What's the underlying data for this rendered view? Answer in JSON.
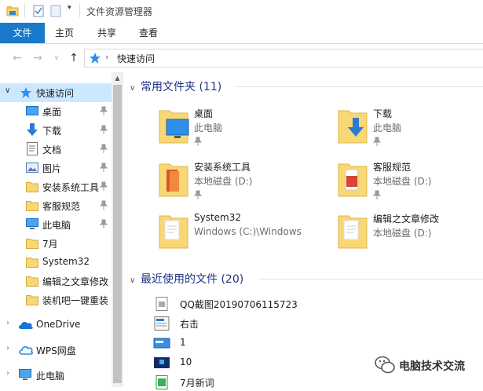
{
  "window": {
    "title": "文件资源管理器"
  },
  "ribbon": {
    "tabs": [
      "文件",
      "主页",
      "共享",
      "查看"
    ]
  },
  "address": {
    "path": "快速访问"
  },
  "nav": {
    "quick_access": "快速访问",
    "items": [
      {
        "label": "桌面",
        "pinned": true
      },
      {
        "label": "下载",
        "pinned": true
      },
      {
        "label": "文档",
        "pinned": true
      },
      {
        "label": "图片",
        "pinned": true
      },
      {
        "label": "安装系统工具",
        "pinned": true
      },
      {
        "label": "客服规范",
        "pinned": true
      },
      {
        "label": "此电脑",
        "pinned": true
      },
      {
        "label": "7月",
        "pinned": false
      },
      {
        "label": "System32",
        "pinned": false
      },
      {
        "label": "编辑之文章修改",
        "pinned": false
      },
      {
        "label": "装机吧一键重装",
        "pinned": false
      }
    ],
    "onedrive": "OneDrive",
    "wps": "WPS网盘",
    "this_pc": "此电脑"
  },
  "frequent": {
    "title": "常用文件夹 (11)",
    "folders": [
      {
        "name": "桌面",
        "location": "此电脑",
        "pinned": true
      },
      {
        "name": "下载",
        "location": "此电脑",
        "pinned": true
      },
      {
        "name": "安装系统工具",
        "location": "本地磁盘 (D:)",
        "pinned": true
      },
      {
        "name": "客服规范",
        "location": "本地磁盘 (D:)",
        "pinned": true
      },
      {
        "name": "System32",
        "location": "Windows (C:)\\Windows",
        "pinned": false
      },
      {
        "name": "编辑之文章修改",
        "location": "本地磁盘 (D:)",
        "pinned": false
      }
    ]
  },
  "recent": {
    "title": "最近使用的文件 (20)",
    "files": [
      {
        "name": "QQ截图20190706115723"
      },
      {
        "name": "右击"
      },
      {
        "name": "1"
      },
      {
        "name": "10"
      },
      {
        "name": "7月新词"
      }
    ]
  },
  "watermark": {
    "text": "电脑技术交流"
  },
  "colors": {
    "accent": "#1979ca",
    "selection": "#cce8ff",
    "folder": "#f8d775",
    "heading": "#1e3287"
  }
}
